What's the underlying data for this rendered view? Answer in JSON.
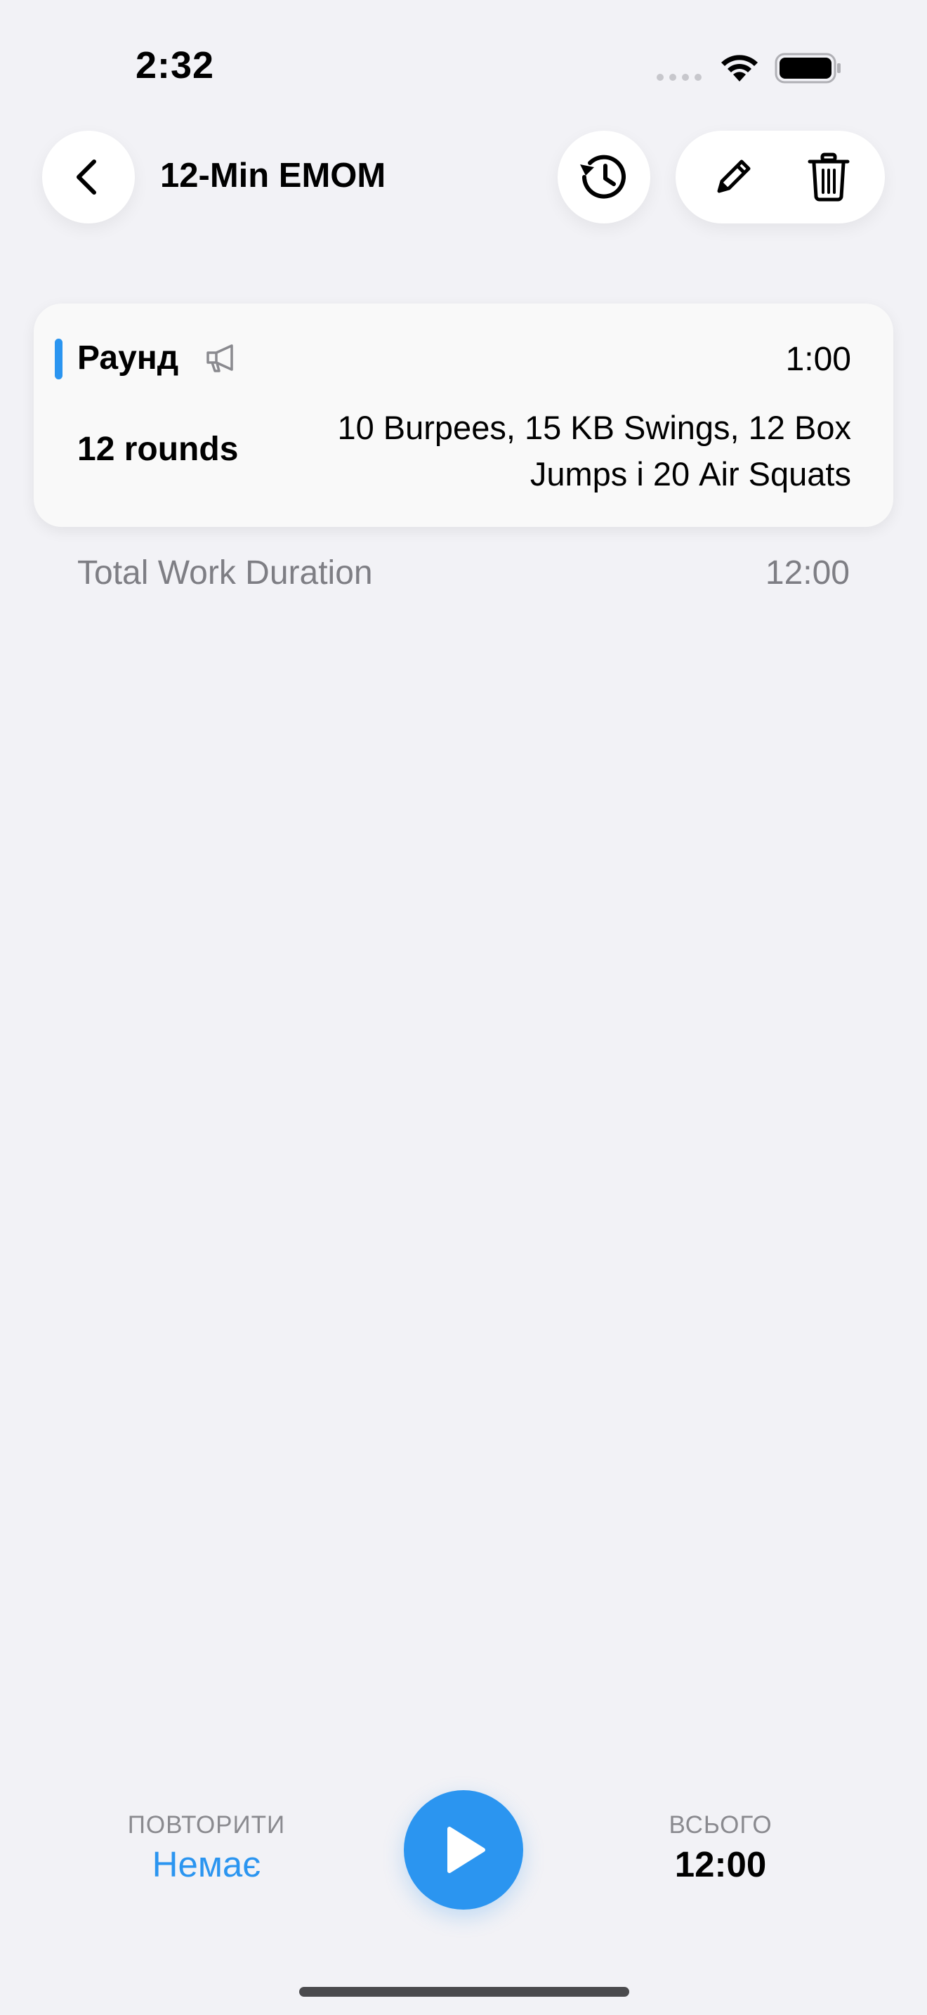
{
  "status_bar": {
    "time": "2:32"
  },
  "header": {
    "title": "12-Min EMOM",
    "icons": {
      "back": "chevron-left-icon",
      "history": "history-icon",
      "edit": "pencil-icon",
      "delete": "trash-icon"
    }
  },
  "round_card": {
    "label": "Раунд",
    "duration": "1:00",
    "rounds": "12 rounds",
    "exercises": "10 Burpees, 15 KB Swings, 12 Box Jumps і 20 Air Squats",
    "accent_color": "#2b95f0"
  },
  "summary": {
    "total_label": "Total Work Duration",
    "total_value": "12:00"
  },
  "bottom_bar": {
    "repeat_caption": "ПОВТОРИТИ",
    "repeat_value": "Немає",
    "total_caption": "ВСЬОГО",
    "total_value": "12:00"
  },
  "colors": {
    "accent": "#2b95f0",
    "background": "#f2f2f6",
    "secondary_text": "#7e7e84"
  }
}
